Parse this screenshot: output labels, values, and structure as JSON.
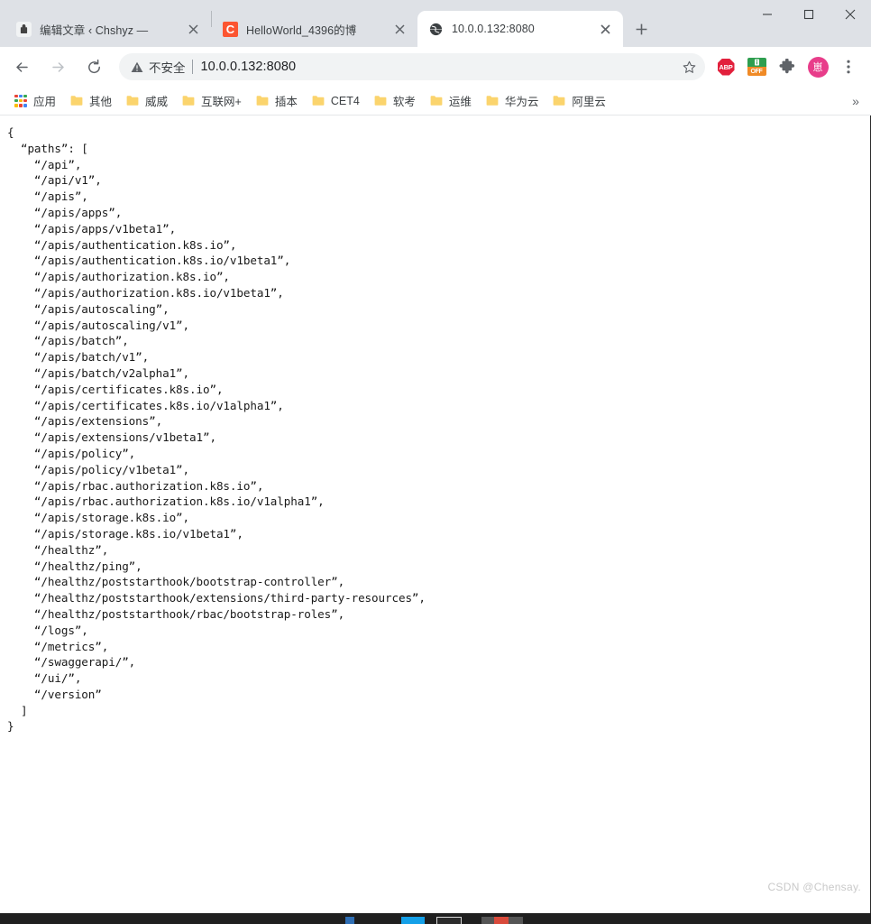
{
  "window": {
    "minimize_label": "minimize",
    "maximize_label": "maximize",
    "close_label": "close"
  },
  "tabs": [
    {
      "title": "编辑文章 ‹ Chshyz —",
      "favicon": "lock-icon",
      "active": false,
      "close_label": "×"
    },
    {
      "title": "HelloWorld_4396的博",
      "favicon": "csdn-c-icon",
      "favicon_text": "C",
      "active": false,
      "close_label": "×"
    },
    {
      "title": "10.0.0.132:8080",
      "favicon": "globe-icon",
      "active": true,
      "close_label": "×"
    }
  ],
  "new_tab_label": "+",
  "toolbar": {
    "back_label": "←",
    "forward_label": "→",
    "reload_label": "⟳",
    "bookmark_star_label": "☆",
    "menu_label": "⋮"
  },
  "omnibox": {
    "security_text": "不安全",
    "url": "10.0.0.132:8080",
    "warning_icon": "warning-triangle-icon"
  },
  "extensions": [
    {
      "name": "adblock-plus",
      "label": "ABP"
    },
    {
      "name": "https-everywhere-off",
      "top_label": "",
      "bottom_label": "OFF"
    },
    {
      "name": "extensions-puzzle",
      "label": ""
    }
  ],
  "avatar": {
    "label": "崽"
  },
  "bookmarks": {
    "apps_label": "应用",
    "items": [
      {
        "label": "其他"
      },
      {
        "label": "威威"
      },
      {
        "label": "互联网+"
      },
      {
        "label": "插本"
      },
      {
        "label": "CET4"
      },
      {
        "label": "软考"
      },
      {
        "label": "运维"
      },
      {
        "label": "华为云"
      },
      {
        "label": "阿里云"
      }
    ],
    "overflow_label": "»"
  },
  "page": {
    "content": "{\n  “paths”: [\n    “/api”,\n    “/api/v1”,\n    “/apis”,\n    “/apis/apps”,\n    “/apis/apps/v1beta1”,\n    “/apis/authentication.k8s.io”,\n    “/apis/authentication.k8s.io/v1beta1”,\n    “/apis/authorization.k8s.io”,\n    “/apis/authorization.k8s.io/v1beta1”,\n    “/apis/autoscaling”,\n    “/apis/autoscaling/v1”,\n    “/apis/batch”,\n    “/apis/batch/v1”,\n    “/apis/batch/v2alpha1”,\n    “/apis/certificates.k8s.io”,\n    “/apis/certificates.k8s.io/v1alpha1”,\n    “/apis/extensions”,\n    “/apis/extensions/v1beta1”,\n    “/apis/policy”,\n    “/apis/policy/v1beta1”,\n    “/apis/rbac.authorization.k8s.io”,\n    “/apis/rbac.authorization.k8s.io/v1alpha1”,\n    “/apis/storage.k8s.io”,\n    “/apis/storage.k8s.io/v1beta1”,\n    “/healthz”,\n    “/healthz/ping”,\n    “/healthz/poststarthook/bootstrap-controller”,\n    “/healthz/poststarthook/extensions/third-party-resources”,\n    “/healthz/poststarthook/rbac/bootstrap-roles”,\n    “/logs”,\n    “/metrics”,\n    “/swaggerapi/”,\n    “/ui/”,\n    “/version”\n  ]\n}",
    "paths": [
      "/api",
      "/api/v1",
      "/apis",
      "/apis/apps",
      "/apis/apps/v1beta1",
      "/apis/authentication.k8s.io",
      "/apis/authentication.k8s.io/v1beta1",
      "/apis/authorization.k8s.io",
      "/apis/authorization.k8s.io/v1beta1",
      "/apis/autoscaling",
      "/apis/autoscaling/v1",
      "/apis/batch",
      "/apis/batch/v1",
      "/apis/batch/v2alpha1",
      "/apis/certificates.k8s.io",
      "/apis/certificates.k8s.io/v1alpha1",
      "/apis/extensions",
      "/apis/extensions/v1beta1",
      "/apis/policy",
      "/apis/policy/v1beta1",
      "/apis/rbac.authorization.k8s.io",
      "/apis/rbac.authorization.k8s.io/v1alpha1",
      "/apis/storage.k8s.io",
      "/apis/storage.k8s.io/v1beta1",
      "/healthz",
      "/healthz/ping",
      "/healthz/poststarthook/bootstrap-controller",
      "/healthz/poststarthook/extensions/third-party-resources",
      "/healthz/poststarthook/rbac/bootstrap-roles",
      "/logs",
      "/metrics",
      "/swaggerapi/",
      "/ui/",
      "/version"
    ]
  },
  "watermark": "CSDN @Chensay.",
  "colors": {
    "tabstrip_bg": "#dee1e6",
    "omnibox_bg": "#f1f3f4",
    "csdn_orange": "#fc5531",
    "abp_red": "#e2203c",
    "avatar_pink": "#e83d8a",
    "folder_yellow": "#fbd46d",
    "text": "#3c4043"
  }
}
